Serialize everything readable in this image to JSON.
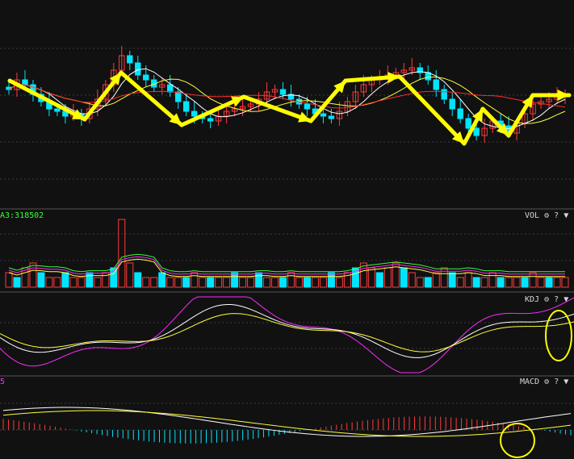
{
  "colors": {
    "background": "#111111",
    "grid": "#3a3a3a",
    "divider": "#555555",
    "up": "#ff3b3b",
    "down": "#00e5ff",
    "ma_white": "#ffffff",
    "ma_yellow": "#ffff3a",
    "ma_red": "#ff2a2a",
    "kdj_k": "#ffffff",
    "kdj_d": "#ffff3a",
    "kdj_j": "#ff2aff",
    "macd_dif": "#ffffff",
    "macd_dea": "#ffff3a",
    "vol_ma1": "#ffff3a",
    "vol_ma2": "#ff2aff",
    "vol_ma3": "#37ff37",
    "annotation": "#ffff00"
  },
  "vol_panel": {
    "readout": "A3:318502",
    "name": "VOL",
    "gear_icon": "gear-icon",
    "help": "?",
    "nav": "▼"
  },
  "kdj_panel": {
    "name": "KDJ",
    "gear_icon": "gear-icon",
    "help": "?",
    "nav": "▼"
  },
  "macd_panel": {
    "readout": "5",
    "name": "MACD",
    "gear_icon": "gear-icon",
    "help": "?",
    "nav": "▼"
  },
  "chart_data": [
    {
      "type": "candlestick",
      "panel": "price",
      "grid": true,
      "series_closes": [
        108,
        112,
        110,
        106,
        103,
        100,
        99,
        97,
        98,
        96,
        100,
        104,
        110,
        116,
        122,
        119,
        114,
        112,
        109,
        110,
        107,
        103,
        99,
        97,
        96,
        95,
        97,
        99,
        100,
        101,
        102,
        104,
        107,
        108,
        106,
        104,
        102,
        100,
        98,
        97,
        96,
        99,
        103,
        107,
        110,
        112,
        113,
        114,
        115,
        116,
        117,
        115,
        112,
        108,
        104,
        100,
        96,
        92,
        89,
        92,
        95,
        93,
        90,
        94,
        98,
        102,
        103,
        104,
        105,
        106
      ],
      "moving_averages": [
        "white",
        "yellow",
        "red"
      ],
      "annotations": [
        "yellow zigzag trend arrows"
      ]
    },
    {
      "type": "bar",
      "panel": "volume",
      "grid": true,
      "values": [
        3,
        2,
        4,
        5,
        3,
        2,
        2,
        3,
        2,
        2,
        3,
        2,
        3,
        4,
        14,
        5,
        3,
        2,
        2,
        3,
        2,
        2,
        2,
        3,
        2,
        2,
        2,
        2,
        3,
        2,
        2,
        3,
        2,
        2,
        2,
        3,
        2,
        2,
        2,
        2,
        3,
        2,
        3,
        4,
        5,
        4,
        3,
        4,
        5,
        4,
        3,
        2,
        2,
        3,
        4,
        3,
        2,
        3,
        2,
        2,
        3,
        2,
        2,
        2,
        2,
        3,
        2,
        2,
        2,
        2
      ],
      "moving_average_count": 3
    },
    {
      "type": "line",
      "panel": "KDJ",
      "grid": true,
      "series": [
        "K",
        "D",
        "J"
      ],
      "annotations": [
        "yellow ellipse at right edge"
      ]
    },
    {
      "type": "bar",
      "panel": "MACD",
      "grid": true,
      "series": [
        "DIF",
        "DEA",
        "histogram"
      ],
      "annotations": [
        "yellow circle near lower crossover"
      ]
    }
  ]
}
